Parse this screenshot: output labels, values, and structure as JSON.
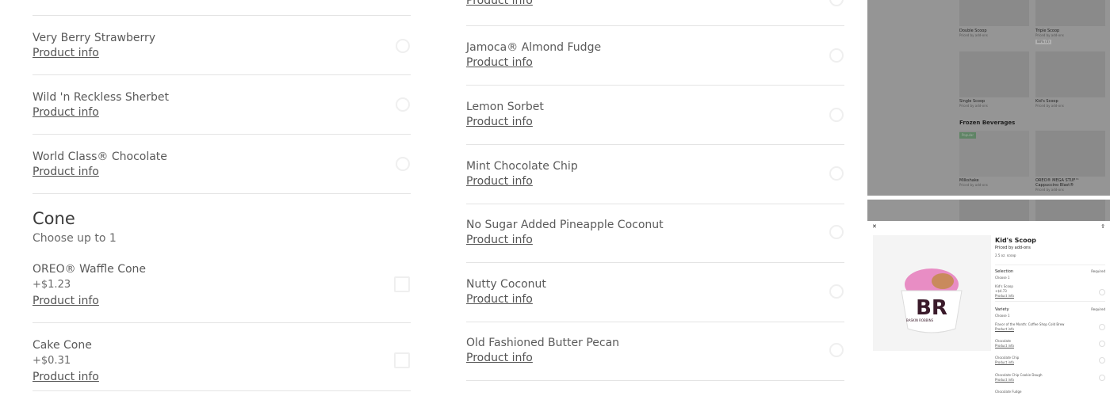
{
  "colors": {
    "accent_green": "#1f7a2e",
    "divider": "#e4e4e4",
    "preview_gray": "#959595"
  },
  "product_info_label": "Product info",
  "left_flavors": [
    {
      "name": "Very Berry Strawberry"
    },
    {
      "name": "Wild 'n Reckless Sherbet"
    },
    {
      "name": "World Class® Chocolate"
    }
  ],
  "cone_section": {
    "title": "Cone",
    "subtitle": "Choose up to 1",
    "items": [
      {
        "name": "OREO® Waffle Cone",
        "price": "+$1.23"
      },
      {
        "name": "Cake Cone",
        "price": "+$0.31"
      }
    ]
  },
  "mid_flavors": [
    {
      "name": "Jamoca® Almond Fudge"
    },
    {
      "name": "Lemon Sorbet"
    },
    {
      "name": "Mint Chocolate Chip"
    },
    {
      "name": "No Sugar Added Pineapple Coconut"
    },
    {
      "name": "Nutty Coconut"
    },
    {
      "name": "Old Fashioned Butter Pecan"
    }
  ],
  "preview_menu": {
    "items": [
      {
        "name": "Double Scoop",
        "sub": "Priced by add-ons"
      },
      {
        "name": "Triple Scoop",
        "sub": "Priced by add-ons",
        "rating": "88% (3)"
      },
      {
        "name": "Single Scoop",
        "sub": "Priced by add-ons"
      },
      {
        "name": "Kid's Scoop",
        "sub": "Priced by add-ons"
      }
    ],
    "section": "Frozen Beverages",
    "badge": "Popular",
    "items2": [
      {
        "name": "Milkshake",
        "sub": "Priced by add-ons"
      },
      {
        "name": "OREO® MEGA STUF™ Cappuccino Blast®",
        "sub": "Priced by add-ons"
      }
    ]
  },
  "preview_modal": {
    "title": "Kid's Scoop",
    "price": "Priced by add-ons",
    "size": "2.5 oz. scoop",
    "logo_text": "BASKIN ROBBINS",
    "selection": {
      "label": "Selection",
      "required": "Required",
      "choose": "Choose 1",
      "item": "Kid's Scoop",
      "item_price": "+$4.73",
      "info": "Product info"
    },
    "variety": {
      "label": "Variety",
      "required": "Required",
      "choose": "Choose 1",
      "items": [
        "Flavor of the Month: Coffee Shop Cold Brew",
        "Chocolate",
        "Chocolate Chip",
        "Chocolate Chip Cookie Dough",
        "Chocolate Fudge"
      ],
      "info": "Product info"
    }
  }
}
